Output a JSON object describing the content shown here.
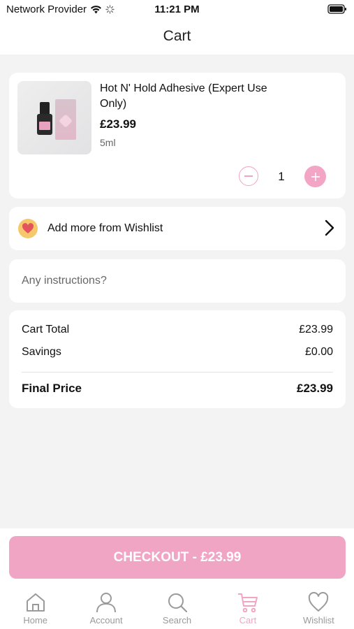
{
  "status_bar": {
    "carrier": "Network Provider",
    "time": "11:21 PM"
  },
  "header": {
    "title": "Cart"
  },
  "cart_item": {
    "name": "Hot N' Hold Adhesive (Expert Use Only)",
    "price": "£23.99",
    "size": "5ml",
    "quantity": "1"
  },
  "wishlist": {
    "label": "Add more from Wishlist"
  },
  "instructions": {
    "placeholder": "Any instructions?"
  },
  "summary": {
    "cart_total_label": "Cart Total",
    "cart_total_value": "£23.99",
    "savings_label": "Savings",
    "savings_value": "£0.00",
    "final_label": "Final Price",
    "final_value": "£23.99"
  },
  "checkout": {
    "label": "CHECKOUT - £23.99"
  },
  "tabs": [
    {
      "label": "Home",
      "icon": "home-icon"
    },
    {
      "label": "Account",
      "icon": "account-icon"
    },
    {
      "label": "Search",
      "icon": "search-icon"
    },
    {
      "label": "Cart",
      "icon": "cart-icon",
      "active": true
    },
    {
      "label": "Wishlist",
      "icon": "heart-icon"
    }
  ],
  "colors": {
    "accent": "#f0a5c5",
    "inactive_tab": "#9a9a9a",
    "background": "#f3f3f3"
  }
}
